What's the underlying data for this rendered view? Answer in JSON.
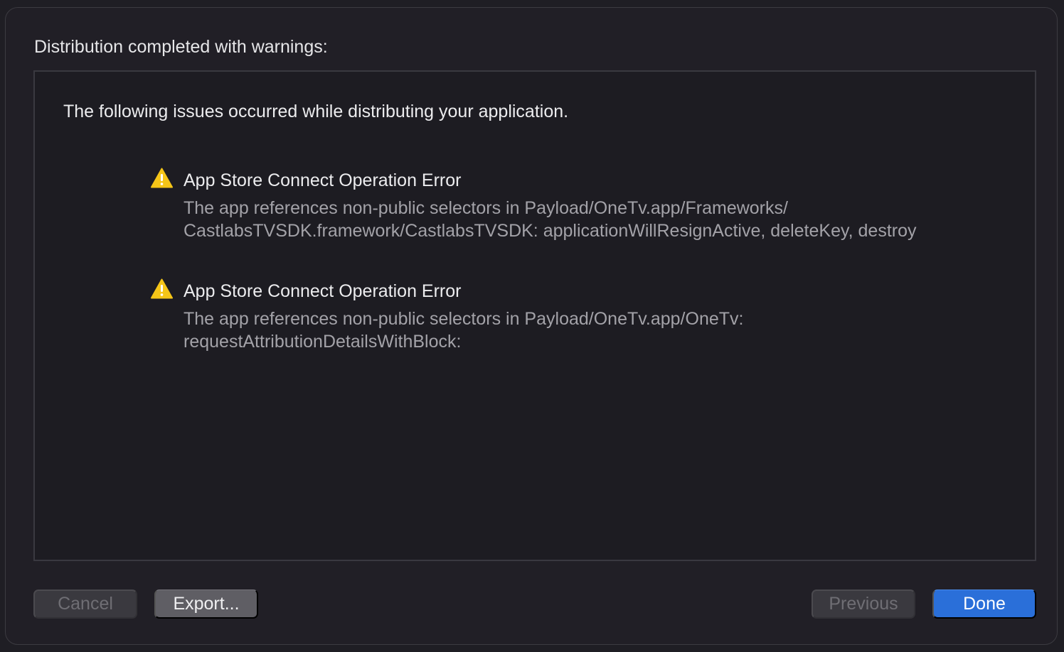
{
  "sheet": {
    "title": "Distribution completed with warnings:"
  },
  "panel": {
    "intro": "The following issues occurred while distributing your application.",
    "issues": [
      {
        "icon": "warning-icon",
        "title": "App Store Connect Operation Error",
        "message_lines": [
          "The app references non-public selectors in Payload/OneTv.app/Frameworks/",
          "CastlabsTVSDK.framework/CastlabsTVSDK: applicationWillResignActive, deleteKey, destroy"
        ]
      },
      {
        "icon": "warning-icon",
        "title": "App Store Connect Operation Error",
        "message_lines": [
          "The app references non-public selectors in Payload/OneTv.app/OneTv:",
          "requestAttributionDetailsWithBlock:"
        ]
      }
    ]
  },
  "buttons": {
    "cancel_label": "Cancel",
    "export_label": "Export...",
    "previous_label": "Previous",
    "done_label": "Done"
  },
  "colors": {
    "background": "#211f26",
    "panel": "#1d1c22",
    "accent": "#2a6fd9",
    "warning": "#f5c518"
  }
}
